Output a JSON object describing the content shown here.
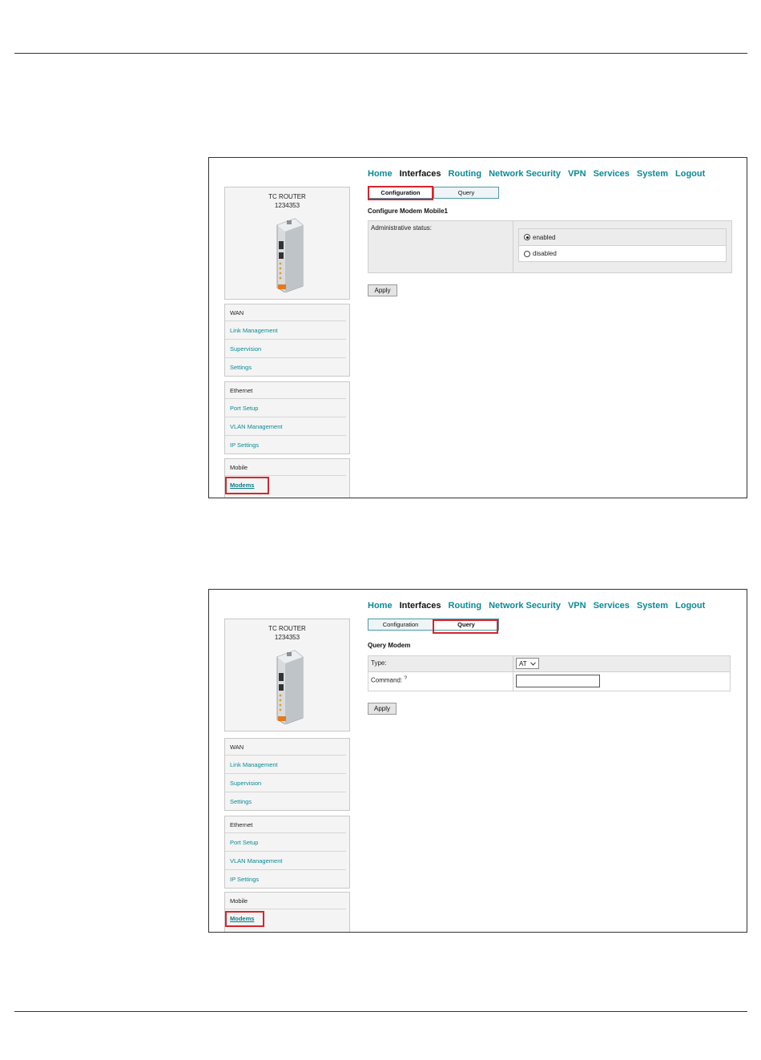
{
  "nav": [
    "Home",
    "Interfaces",
    "Routing",
    "Network Security",
    "VPN",
    "Services",
    "System",
    "Logout"
  ],
  "device": {
    "name": "TC ROUTER",
    "id": "1234353"
  },
  "menu": {
    "wan": {
      "title": "WAN",
      "items": [
        "Link Management",
        "Supervision",
        "Settings"
      ]
    },
    "ethernet": {
      "title": "Ethernet",
      "items": [
        "Port Setup",
        "VLAN Management",
        "IP Settings"
      ]
    },
    "mobile": {
      "title": "Mobile",
      "items": [
        "Modems"
      ]
    }
  },
  "tabs": {
    "configuration": "Configuration",
    "query": "Query"
  },
  "config": {
    "title": "Configure Modem Mobile1",
    "status_label": "Administrative status:",
    "enabled": "enabled",
    "disabled": "disabled",
    "selected": "enabled"
  },
  "query": {
    "title": "Query Modem",
    "type_label": "Type:",
    "type_value": "AT",
    "command_label": "Command:",
    "help": "?",
    "command_value": ""
  },
  "apply": "Apply",
  "colors": {
    "accent": "#0a8a96",
    "highlight": "#d9242b"
  }
}
